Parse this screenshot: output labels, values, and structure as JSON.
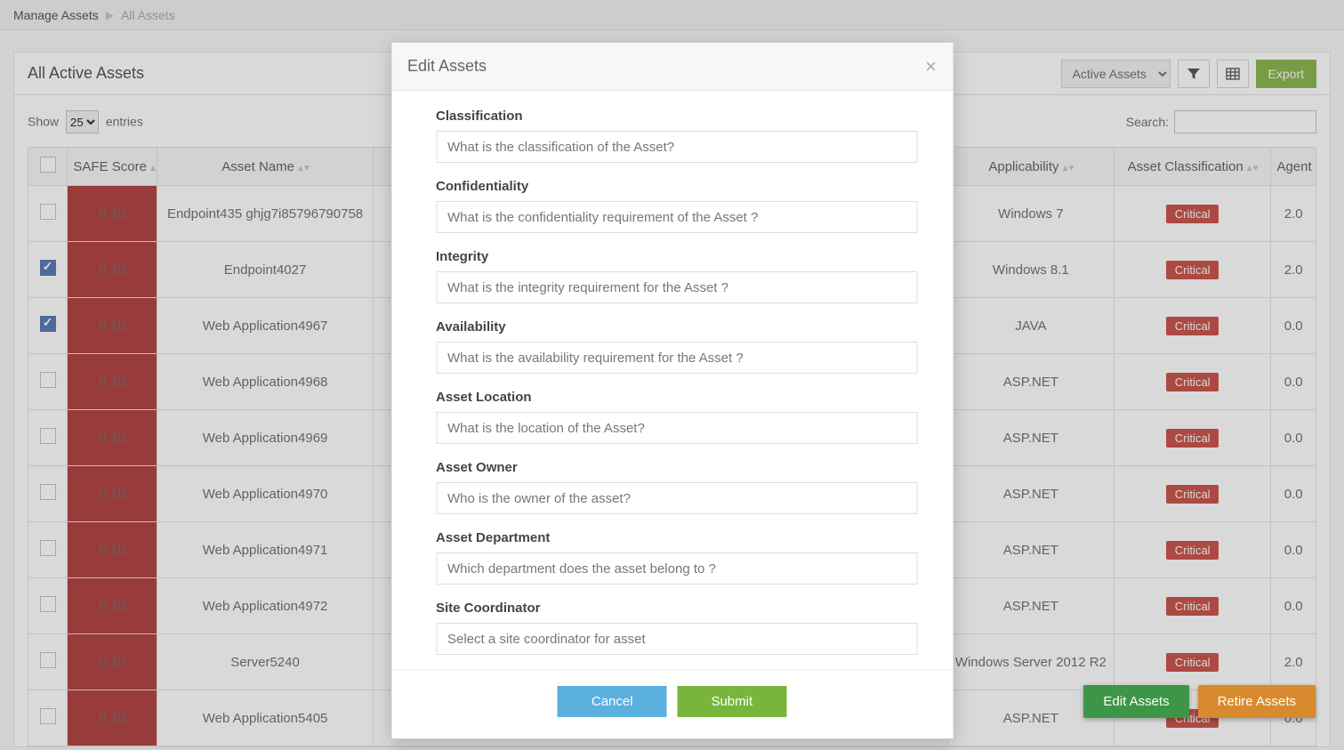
{
  "breadcrumb": {
    "root": "Manage Assets",
    "current": "All Assets"
  },
  "panel": {
    "title": "All Active Assets",
    "filterSelect": "Active Assets",
    "export": "Export",
    "showLabelA": "Show",
    "pageSize": "25",
    "showLabelB": "entries",
    "searchLabel": "Search:"
  },
  "table": {
    "headers": {
      "safe": "SAFE Score",
      "name": "Asset Name",
      "applic": "Applicability",
      "class": "Asset Classification",
      "agent": "Agent"
    },
    "rows": [
      {
        "checked": false,
        "score": "0.10",
        "name": "Endpoint435 ghjg7i85796790758",
        "applic": "Windows 7",
        "class": "Critical",
        "agent": "2.0"
      },
      {
        "checked": true,
        "score": "0.10",
        "name": "Endpoint4027",
        "applic": "Windows 8.1",
        "class": "Critical",
        "agent": "2.0"
      },
      {
        "checked": true,
        "score": "0.10",
        "name": "Web Application4967",
        "applic": "JAVA",
        "class": "Critical",
        "agent": "0.0"
      },
      {
        "checked": false,
        "score": "0.10",
        "name": "Web Application4968",
        "applic": "ASP.NET",
        "class": "Critical",
        "agent": "0.0"
      },
      {
        "checked": false,
        "score": "0.10",
        "name": "Web Application4969",
        "applic": "ASP.NET",
        "class": "Critical",
        "agent": "0.0"
      },
      {
        "checked": false,
        "score": "0.10",
        "name": "Web Application4970",
        "applic": "ASP.NET",
        "class": "Critical",
        "agent": "0.0"
      },
      {
        "checked": false,
        "score": "0.10",
        "name": "Web Application4971",
        "applic": "ASP.NET",
        "class": "Critical",
        "agent": "0.0"
      },
      {
        "checked": false,
        "score": "0.10",
        "name": "Web Application4972",
        "applic": "ASP.NET",
        "class": "Critical",
        "agent": "0.0"
      },
      {
        "checked": false,
        "score": "0.10",
        "name": "Server5240",
        "applic": "Windows Server 2012 R2",
        "class": "Critical",
        "agent": "2.0"
      },
      {
        "checked": false,
        "score": "0.10",
        "name": "Web Application5405",
        "applic": "ASP.NET",
        "class": "Critical",
        "agent": "0.0"
      }
    ]
  },
  "floatButtons": {
    "edit": "Edit Assets",
    "retire": "Retire Assets"
  },
  "modal": {
    "title": "Edit Assets",
    "fields": [
      {
        "label": "Classification",
        "placeholder": "What is the classification of the Asset?"
      },
      {
        "label": "Confidentiality",
        "placeholder": "What is the confidentiality requirement of the Asset ?"
      },
      {
        "label": "Integrity",
        "placeholder": "What is the integrity requirement for the Asset ?"
      },
      {
        "label": "Availability",
        "placeholder": "What is the availability requirement for the Asset ?"
      },
      {
        "label": "Asset Location",
        "placeholder": "What is the location of the Asset?"
      },
      {
        "label": "Asset Owner",
        "placeholder": "Who is the owner of the asset?"
      },
      {
        "label": "Asset Department",
        "placeholder": "Which department does the asset belong to ?"
      },
      {
        "label": "Site Coordinator",
        "placeholder": "Select a site coordinator for asset"
      }
    ],
    "cancel": "Cancel",
    "submit": "Submit"
  }
}
